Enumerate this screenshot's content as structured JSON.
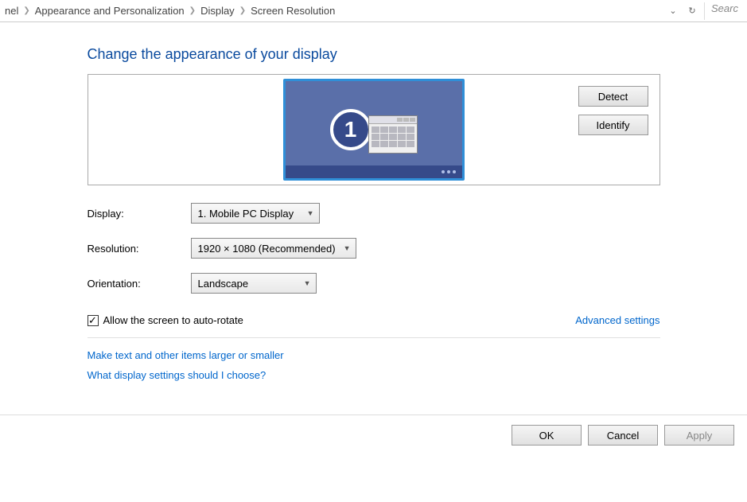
{
  "breadcrumb": {
    "item0": "nel",
    "item1": "Appearance and Personalization",
    "item2": "Display",
    "item3": "Screen Resolution"
  },
  "search": {
    "placeholder": "Searc"
  },
  "heading": "Change the appearance of your display",
  "monitor": {
    "number": "1"
  },
  "buttons": {
    "detect": "Detect",
    "identify": "Identify"
  },
  "labels": {
    "display": "Display:",
    "resolution": "Resolution:",
    "orientation": "Orientation:"
  },
  "selects": {
    "display_value": "1. Mobile PC Display",
    "resolution_value": "1920 × 1080 (Recommended)",
    "orientation_value": "Landscape"
  },
  "checkbox": {
    "checked": true,
    "label": "Allow the screen to auto-rotate"
  },
  "links": {
    "advanced": "Advanced settings",
    "text_size": "Make text and other items larger or smaller",
    "help": "What display settings should I choose?"
  },
  "dialog": {
    "ok": "OK",
    "cancel": "Cancel",
    "apply": "Apply"
  }
}
